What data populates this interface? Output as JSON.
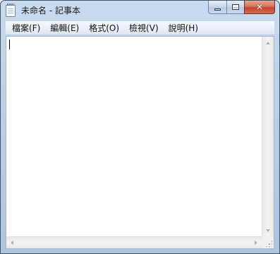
{
  "window": {
    "title": "未命名 - 記事本",
    "icon": "notepad-icon",
    "close_color": "#c7432b",
    "frame_color": "#bcd0e6"
  },
  "menu": {
    "items": [
      {
        "label": "檔案(F)"
      },
      {
        "label": "編輯(E)"
      },
      {
        "label": "格式(O)"
      },
      {
        "label": "檢視(V)"
      },
      {
        "label": "說明(H)"
      }
    ]
  },
  "editor": {
    "text": ""
  }
}
